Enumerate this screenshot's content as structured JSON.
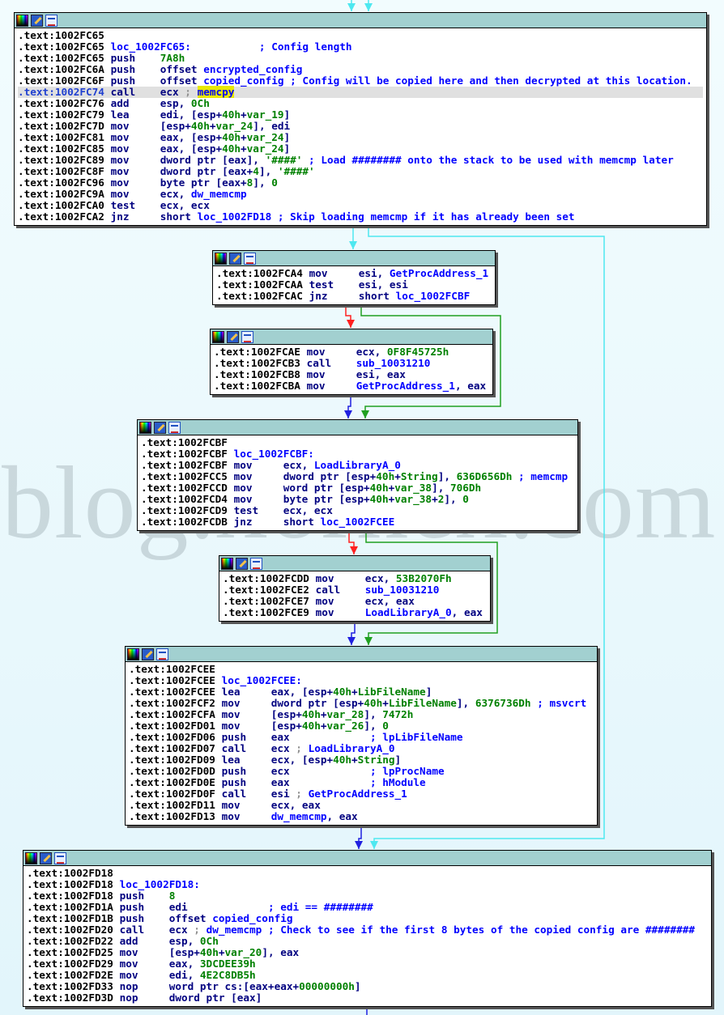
{
  "watermark": "blog.xorhex.com",
  "edge_colors": {
    "cyan": "#4ee8f0",
    "red": "#ff2020",
    "green": "#20a020",
    "blue": "#2020e0"
  },
  "blocks": [
    {
      "lines": [
        {
          "addr": ".text:1002FC65"
        },
        {
          "addr": ".text:1002FC65",
          "t": [
            [
              "n",
              "loc_1002FC65:"
            ],
            [
              "c",
              "           ; Config length"
            ]
          ]
        },
        {
          "addr": ".text:1002FC65",
          "mn": "push",
          "t": [
            [
              "k",
              "7A8h"
            ]
          ]
        },
        {
          "addr": ".text:1002FC6A",
          "mn": "push",
          "t": [
            [
              "o",
              "offset "
            ],
            [
              "n",
              "encrypted_config"
            ]
          ]
        },
        {
          "addr": ".text:1002FC6F",
          "mn": "push",
          "t": [
            [
              "o",
              "offset "
            ],
            [
              "n",
              "copied_config"
            ],
            [
              "c",
              " ; Config will be copied here and then decrypted at this location."
            ]
          ]
        },
        {
          "addr": ".text:1002FC74",
          "mn": "call",
          "hl": true,
          "t": [
            [
              "o",
              "ecx "
            ],
            [
              "g",
              "; "
            ],
            [
              "y",
              "memcpy"
            ]
          ]
        },
        {
          "addr": ".text:1002FC76",
          "mn": "add",
          "t": [
            [
              "o",
              "esp, "
            ],
            [
              "k",
              "0Ch"
            ]
          ]
        },
        {
          "addr": ".text:1002FC79",
          "mn": "lea",
          "t": [
            [
              "o",
              "edi, [esp+"
            ],
            [
              "k",
              "40h"
            ],
            [
              "o",
              "+"
            ],
            [
              "k",
              "var_19"
            ],
            [
              "o",
              "]"
            ]
          ]
        },
        {
          "addr": ".text:1002FC7D",
          "mn": "mov",
          "t": [
            [
              "o",
              "[esp+"
            ],
            [
              "k",
              "40h"
            ],
            [
              "o",
              "+"
            ],
            [
              "k",
              "var_24"
            ],
            [
              "o",
              "], edi"
            ]
          ]
        },
        {
          "addr": ".text:1002FC81",
          "mn": "mov",
          "t": [
            [
              "o",
              "eax, [esp+"
            ],
            [
              "k",
              "40h"
            ],
            [
              "o",
              "+"
            ],
            [
              "k",
              "var_24"
            ],
            [
              "o",
              "]"
            ]
          ]
        },
        {
          "addr": ".text:1002FC85",
          "mn": "mov",
          "t": [
            [
              "o",
              "eax, [esp+"
            ],
            [
              "k",
              "40h"
            ],
            [
              "o",
              "+"
            ],
            [
              "k",
              "var_24"
            ],
            [
              "o",
              "]"
            ]
          ]
        },
        {
          "addr": ".text:1002FC89",
          "mn": "mov",
          "t": [
            [
              "o",
              "dword ptr [eax], "
            ],
            [
              "k",
              "'####'"
            ],
            [
              "c",
              " ; Load ######## onto the stack to be used with memcmp later"
            ]
          ]
        },
        {
          "addr": ".text:1002FC8F",
          "mn": "mov",
          "t": [
            [
              "o",
              "dword ptr [eax+"
            ],
            [
              "k",
              "4"
            ],
            [
              "o",
              "], "
            ],
            [
              "k",
              "'####'"
            ]
          ]
        },
        {
          "addr": ".text:1002FC96",
          "mn": "mov",
          "t": [
            [
              "o",
              "byte ptr [eax+"
            ],
            [
              "k",
              "8"
            ],
            [
              "o",
              "], "
            ],
            [
              "k",
              "0"
            ]
          ]
        },
        {
          "addr": ".text:1002FC9A",
          "mn": "mov",
          "t": [
            [
              "o",
              "ecx, "
            ],
            [
              "n",
              "dw_memcmp"
            ]
          ]
        },
        {
          "addr": ".text:1002FCA0",
          "mn": "test",
          "t": [
            [
              "o",
              "ecx, ecx"
            ]
          ]
        },
        {
          "addr": ".text:1002FCA2",
          "mn": "jnz",
          "t": [
            [
              "o",
              "short "
            ],
            [
              "n",
              "loc_1002FD18"
            ],
            [
              "c",
              " ; Skip loading memcmp if it has already been set"
            ]
          ]
        }
      ]
    },
    {
      "lines": [
        {
          "addr": ".text:1002FCA4",
          "mn": "mov",
          "t": [
            [
              "o",
              "esi, "
            ],
            [
              "n",
              "GetProcAddress_1"
            ]
          ]
        },
        {
          "addr": ".text:1002FCAA",
          "mn": "test",
          "t": [
            [
              "o",
              "esi, esi"
            ]
          ]
        },
        {
          "addr": ".text:1002FCAC",
          "mn": "jnz",
          "t": [
            [
              "o",
              "short "
            ],
            [
              "n",
              "loc_1002FCBF"
            ]
          ]
        }
      ]
    },
    {
      "lines": [
        {
          "addr": ".text:1002FCAE",
          "mn": "mov",
          "t": [
            [
              "o",
              "ecx, "
            ],
            [
              "k",
              "0F8F45725h"
            ]
          ]
        },
        {
          "addr": ".text:1002FCB3",
          "mn": "call",
          "t": [
            [
              "n",
              "sub_10031210"
            ]
          ]
        },
        {
          "addr": ".text:1002FCB8",
          "mn": "mov",
          "t": [
            [
              "o",
              "esi, eax"
            ]
          ]
        },
        {
          "addr": ".text:1002FCBA",
          "mn": "mov",
          "t": [
            [
              "n",
              "GetProcAddress_1"
            ],
            [
              "o",
              ", eax"
            ]
          ]
        }
      ]
    },
    {
      "lines": [
        {
          "addr": ".text:1002FCBF"
        },
        {
          "addr": ".text:1002FCBF",
          "t": [
            [
              "n",
              "loc_1002FCBF:"
            ]
          ]
        },
        {
          "addr": ".text:1002FCBF",
          "mn": "mov",
          "t": [
            [
              "o",
              "ecx, "
            ],
            [
              "n",
              "LoadLibraryA_0"
            ]
          ]
        },
        {
          "addr": ".text:1002FCC5",
          "mn": "mov",
          "t": [
            [
              "o",
              "dword ptr [esp+"
            ],
            [
              "k",
              "40h"
            ],
            [
              "o",
              "+"
            ],
            [
              "k",
              "String"
            ],
            [
              "o",
              "], "
            ],
            [
              "k",
              "636D656Dh"
            ],
            [
              "c",
              " ; memcmp"
            ]
          ]
        },
        {
          "addr": ".text:1002FCCD",
          "mn": "mov",
          "t": [
            [
              "o",
              "word ptr [esp+"
            ],
            [
              "k",
              "40h"
            ],
            [
              "o",
              "+"
            ],
            [
              "k",
              "var_38"
            ],
            [
              "o",
              "], "
            ],
            [
              "k",
              "706Dh"
            ]
          ]
        },
        {
          "addr": ".text:1002FCD4",
          "mn": "mov",
          "t": [
            [
              "o",
              "byte ptr [esp+"
            ],
            [
              "k",
              "40h"
            ],
            [
              "o",
              "+"
            ],
            [
              "k",
              "var_38"
            ],
            [
              "o",
              "+"
            ],
            [
              "k",
              "2"
            ],
            [
              "o",
              "], "
            ],
            [
              "k",
              "0"
            ]
          ]
        },
        {
          "addr": ".text:1002FCD9",
          "mn": "test",
          "t": [
            [
              "o",
              "ecx, ecx"
            ]
          ]
        },
        {
          "addr": ".text:1002FCDB",
          "mn": "jnz",
          "t": [
            [
              "o",
              "short "
            ],
            [
              "n",
              "loc_1002FCEE"
            ]
          ]
        }
      ]
    },
    {
      "lines": [
        {
          "addr": ".text:1002FCDD",
          "mn": "mov",
          "t": [
            [
              "o",
              "ecx, "
            ],
            [
              "k",
              "53B2070Fh"
            ]
          ]
        },
        {
          "addr": ".text:1002FCE2",
          "mn": "call",
          "t": [
            [
              "n",
              "sub_10031210"
            ]
          ]
        },
        {
          "addr": ".text:1002FCE7",
          "mn": "mov",
          "t": [
            [
              "o",
              "ecx, eax"
            ]
          ]
        },
        {
          "addr": ".text:1002FCE9",
          "mn": "mov",
          "t": [
            [
              "n",
              "LoadLibraryA_0"
            ],
            [
              "o",
              ", eax"
            ]
          ]
        }
      ]
    },
    {
      "lines": [
        {
          "addr": ".text:1002FCEE"
        },
        {
          "addr": ".text:1002FCEE",
          "t": [
            [
              "n",
              "loc_1002FCEE:"
            ]
          ]
        },
        {
          "addr": ".text:1002FCEE",
          "mn": "lea",
          "t": [
            [
              "o",
              "eax, [esp+"
            ],
            [
              "k",
              "40h"
            ],
            [
              "o",
              "+"
            ],
            [
              "k",
              "LibFileName"
            ],
            [
              "o",
              "]"
            ]
          ]
        },
        {
          "addr": ".text:1002FCF2",
          "mn": "mov",
          "t": [
            [
              "o",
              "dword ptr [esp+"
            ],
            [
              "k",
              "40h"
            ],
            [
              "o",
              "+"
            ],
            [
              "k",
              "LibFileName"
            ],
            [
              "o",
              "], "
            ],
            [
              "k",
              "6376736Dh"
            ],
            [
              "c",
              " ; msvcrt"
            ]
          ]
        },
        {
          "addr": ".text:1002FCFA",
          "mn": "mov",
          "t": [
            [
              "o",
              "[esp+"
            ],
            [
              "k",
              "40h"
            ],
            [
              "o",
              "+"
            ],
            [
              "k",
              "var_28"
            ],
            [
              "o",
              "], "
            ],
            [
              "k",
              "7472h"
            ]
          ]
        },
        {
          "addr": ".text:1002FD01",
          "mn": "mov",
          "t": [
            [
              "o",
              "[esp+"
            ],
            [
              "k",
              "40h"
            ],
            [
              "o",
              "+"
            ],
            [
              "k",
              "var_26"
            ],
            [
              "o",
              "], "
            ],
            [
              "k",
              "0"
            ]
          ]
        },
        {
          "addr": ".text:1002FD06",
          "mn": "push",
          "t": [
            [
              "o",
              "eax"
            ],
            [
              "c",
              "             ; lpLibFileName"
            ]
          ]
        },
        {
          "addr": ".text:1002FD07",
          "mn": "call",
          "t": [
            [
              "o",
              "ecx "
            ],
            [
              "g",
              "; "
            ],
            [
              "n",
              "LoadLibraryA_0"
            ]
          ]
        },
        {
          "addr": ".text:1002FD09",
          "mn": "lea",
          "t": [
            [
              "o",
              "ecx, [esp+"
            ],
            [
              "k",
              "40h"
            ],
            [
              "o",
              "+"
            ],
            [
              "k",
              "String"
            ],
            [
              "o",
              "]"
            ]
          ]
        },
        {
          "addr": ".text:1002FD0D",
          "mn": "push",
          "t": [
            [
              "o",
              "ecx"
            ],
            [
              "c",
              "             ; lpProcName"
            ]
          ]
        },
        {
          "addr": ".text:1002FD0E",
          "mn": "push",
          "t": [
            [
              "o",
              "eax"
            ],
            [
              "c",
              "             ; hModule"
            ]
          ]
        },
        {
          "addr": ".text:1002FD0F",
          "mn": "call",
          "t": [
            [
              "o",
              "esi "
            ],
            [
              "g",
              "; "
            ],
            [
              "n",
              "GetProcAddress_1"
            ]
          ]
        },
        {
          "addr": ".text:1002FD11",
          "mn": "mov",
          "t": [
            [
              "o",
              "ecx, eax"
            ]
          ]
        },
        {
          "addr": ".text:1002FD13",
          "mn": "mov",
          "t": [
            [
              "n",
              "dw_memcmp"
            ],
            [
              "o",
              ", eax"
            ]
          ]
        }
      ]
    },
    {
      "lines": [
        {
          "addr": ".text:1002FD18"
        },
        {
          "addr": ".text:1002FD18",
          "t": [
            [
              "n",
              "loc_1002FD18:"
            ]
          ]
        },
        {
          "addr": ".text:1002FD18",
          "mn": "push",
          "t": [
            [
              "k",
              "8"
            ]
          ]
        },
        {
          "addr": ".text:1002FD1A",
          "mn": "push",
          "t": [
            [
              "o",
              "edi"
            ],
            [
              "c",
              "             ; edi == ########"
            ]
          ]
        },
        {
          "addr": ".text:1002FD1B",
          "mn": "push",
          "t": [
            [
              "o",
              "offset "
            ],
            [
              "n",
              "copied_config"
            ]
          ]
        },
        {
          "addr": ".text:1002FD20",
          "mn": "call",
          "t": [
            [
              "o",
              "ecx "
            ],
            [
              "g",
              "; "
            ],
            [
              "n",
              "dw_memcmp"
            ],
            [
              "c",
              " ; Check to see if the first 8 bytes of the copied config are ########"
            ]
          ]
        },
        {
          "addr": ".text:1002FD22",
          "mn": "add",
          "t": [
            [
              "o",
              "esp, "
            ],
            [
              "k",
              "0Ch"
            ]
          ]
        },
        {
          "addr": ".text:1002FD25",
          "mn": "mov",
          "t": [
            [
              "o",
              "[esp+"
            ],
            [
              "k",
              "40h"
            ],
            [
              "o",
              "+"
            ],
            [
              "k",
              "var_20"
            ],
            [
              "o",
              "], eax"
            ]
          ]
        },
        {
          "addr": ".text:1002FD29",
          "mn": "mov",
          "t": [
            [
              "o",
              "eax, "
            ],
            [
              "k",
              "3DCDEE39h"
            ]
          ]
        },
        {
          "addr": ".text:1002FD2E",
          "mn": "mov",
          "t": [
            [
              "o",
              "edi, "
            ],
            [
              "k",
              "4E2C8DB5h"
            ]
          ]
        },
        {
          "addr": ".text:1002FD33",
          "mn": "nop",
          "t": [
            [
              "o",
              "word ptr cs:[eax+eax+"
            ],
            [
              "k",
              "00000000h"
            ],
            [
              "o",
              "]"
            ]
          ]
        },
        {
          "addr": ".text:1002FD3D",
          "mn": "nop",
          "t": [
            [
              "o",
              "dword ptr [eax]"
            ]
          ]
        }
      ]
    }
  ]
}
